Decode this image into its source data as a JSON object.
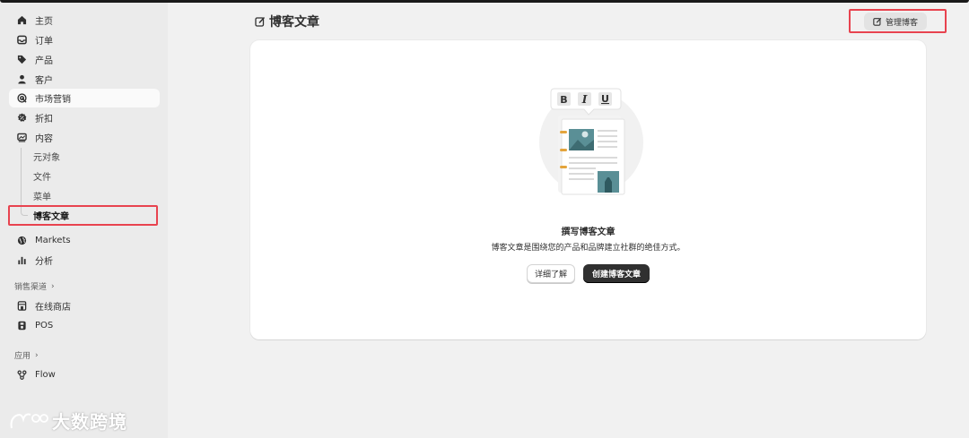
{
  "sidebar": {
    "items": [
      {
        "label": "主页",
        "icon": "home-icon"
      },
      {
        "label": "订单",
        "icon": "inbox-icon"
      },
      {
        "label": "产品",
        "icon": "tag-icon"
      },
      {
        "label": "客户",
        "icon": "person-icon"
      },
      {
        "label": "市场营销",
        "icon": "target-icon"
      },
      {
        "label": "折扣",
        "icon": "discount-icon"
      },
      {
        "label": "内容",
        "icon": "content-icon"
      }
    ],
    "content_sub": [
      "元对象",
      "文件",
      "菜单",
      "博客文章"
    ],
    "items2": [
      {
        "label": "Markets",
        "icon": "globe-icon"
      },
      {
        "label": "分析",
        "icon": "chart-bar-icon"
      }
    ],
    "sales_channels_label": "销售渠道",
    "channels": [
      {
        "label": "在线商店",
        "icon": "store-icon"
      },
      {
        "label": "POS",
        "icon": "pos-icon"
      }
    ],
    "apps_label": "应用",
    "apps": [
      {
        "label": "Flow",
        "icon": "flow-icon"
      }
    ]
  },
  "watermark": {
    "text": "大数跨境"
  },
  "header": {
    "title": "博客文章",
    "manage_button": "管理博客"
  },
  "empty_state": {
    "toolbar_letters": [
      "B",
      "I",
      "U"
    ],
    "title": "撰写博客文章",
    "description": "博客文章是围绕您的产品和品牌建立社群的绝佳方式。",
    "secondary_button": "详细了解",
    "primary_button": "创建博客文章"
  },
  "colors": {
    "highlight": "#e8434f",
    "primary_button": "#303030",
    "illustration_teal": "#5a8f96"
  }
}
